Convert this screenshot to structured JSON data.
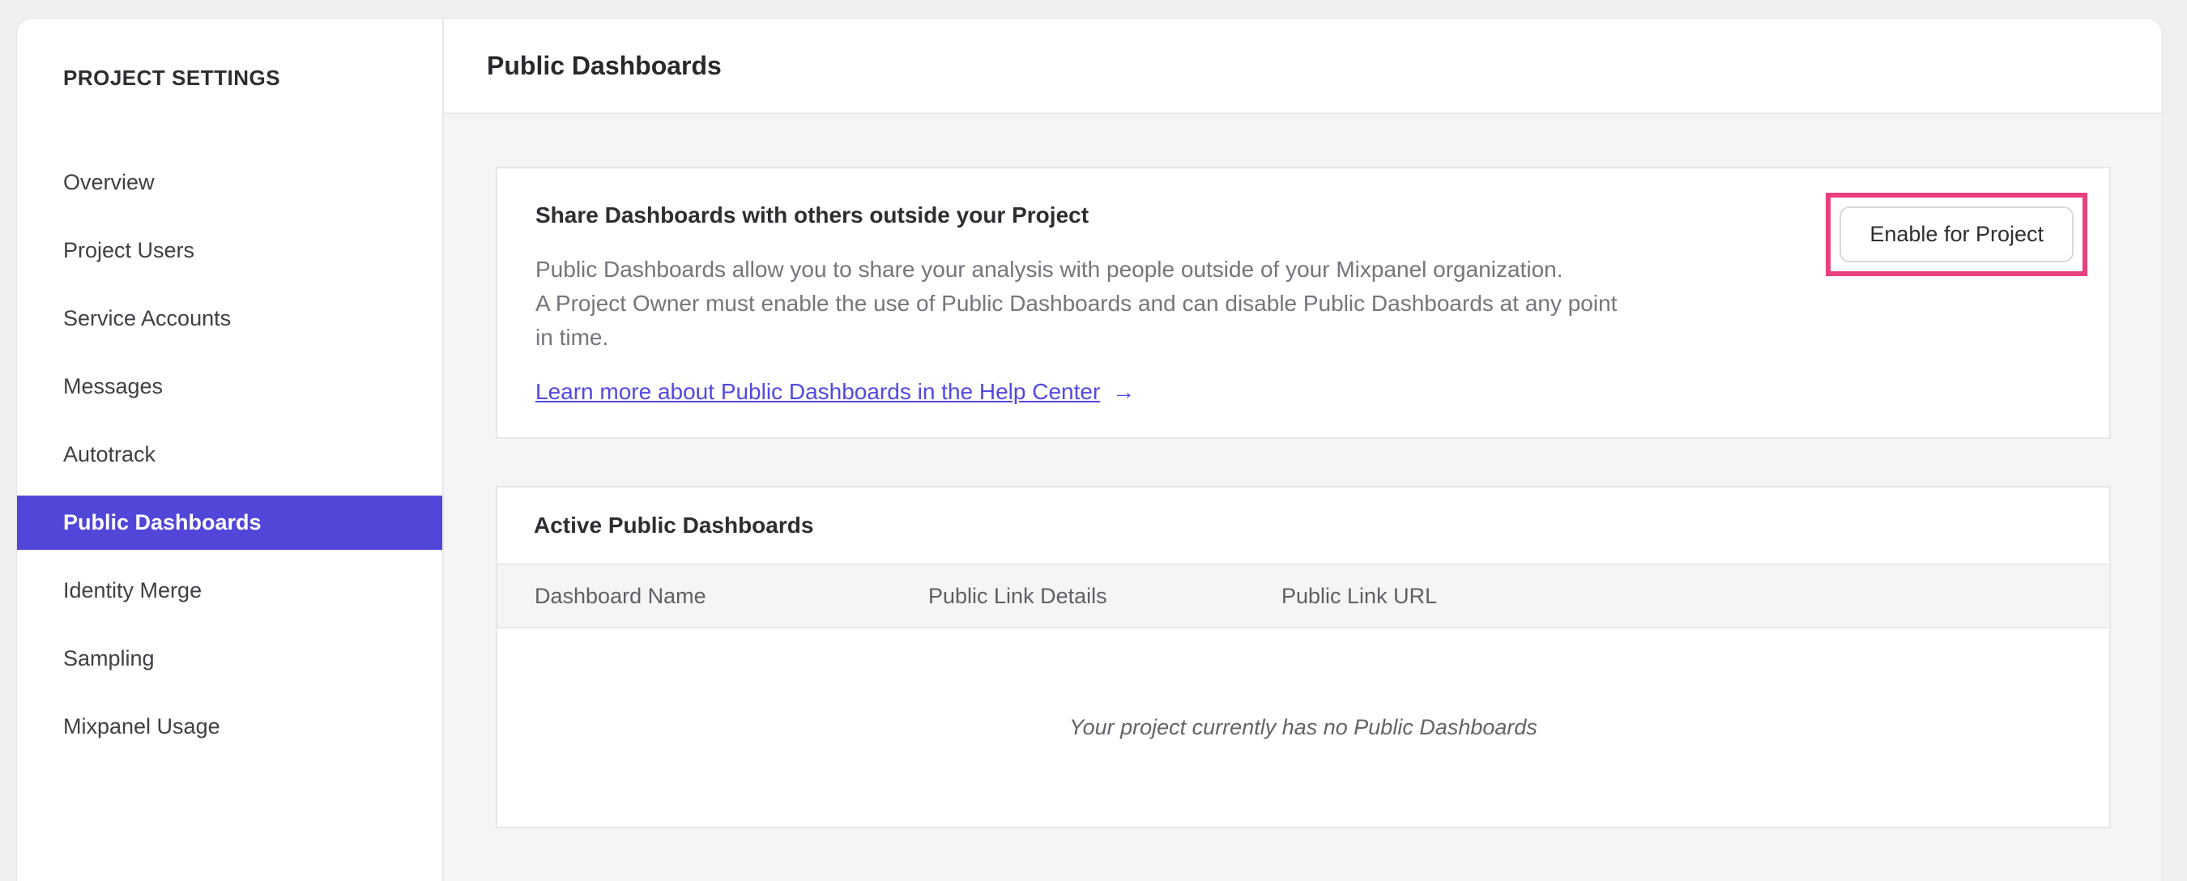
{
  "sidebar": {
    "title": "PROJECT SETTINGS",
    "items": [
      {
        "label": "Overview"
      },
      {
        "label": "Project Users"
      },
      {
        "label": "Service Accounts"
      },
      {
        "label": "Messages"
      },
      {
        "label": "Autotrack"
      },
      {
        "label": "Public Dashboards",
        "selected": true
      },
      {
        "label": "Identity Merge"
      },
      {
        "label": "Sampling"
      },
      {
        "label": "Mixpanel Usage"
      }
    ]
  },
  "header": {
    "title": "Public Dashboards"
  },
  "share_card": {
    "title": "Share Dashboards with others outside your Project",
    "description_lines": [
      "Public Dashboards allow you to share your analysis with people outside of your Mixpanel organization.",
      "A Project Owner must enable the use of Public Dashboards and can disable Public Dashboards at any point",
      "in time."
    ],
    "link_label": "Learn more about Public Dashboards in the Help Center",
    "link_arrow": "→",
    "enable_button_label": "Enable for Project"
  },
  "active_card": {
    "title": "Active Public Dashboards",
    "columns": [
      "Dashboard Name",
      "Public Link Details",
      "Public Link URL"
    ],
    "empty_message": "Your project currently has no Public Dashboards"
  },
  "colors": {
    "selected_nav_bg": "#5146d8",
    "link": "#5348e4",
    "highlight_pink": "#e8407e",
    "content_bg": "#f5f5f6",
    "card_border": "#e7e7e9"
  }
}
